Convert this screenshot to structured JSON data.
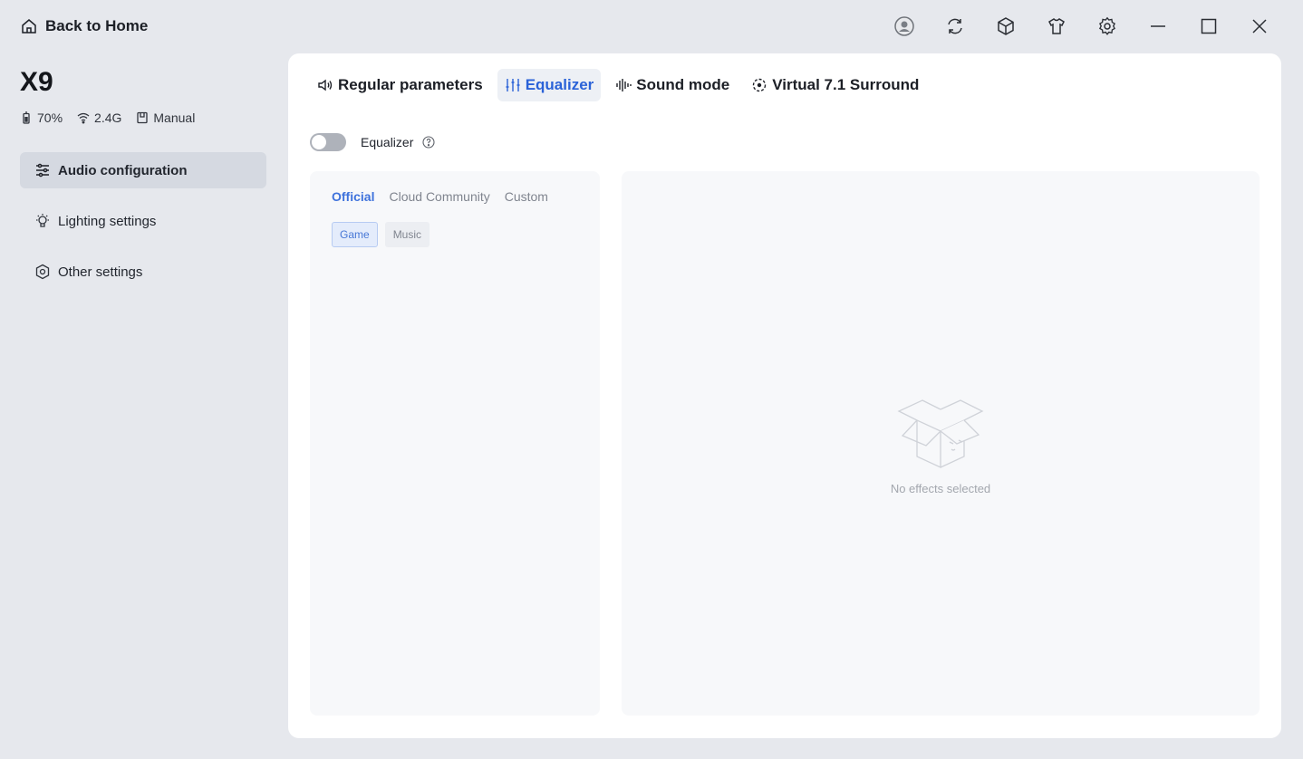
{
  "topbar": {
    "back_label": "Back to Home"
  },
  "window_icons": [
    "user-avatar-icon",
    "sync-icon",
    "cube-icon",
    "shirt-icon",
    "gear-icon",
    "minimize-icon",
    "maximize-icon",
    "close-icon"
  ],
  "device": {
    "name": "X9",
    "battery": "70%",
    "connection": "2.4G",
    "mode": "Manual"
  },
  "sidebar": {
    "items": [
      {
        "label": "Audio configuration",
        "icon": "sliders-icon",
        "active": true
      },
      {
        "label": "Lighting settings",
        "icon": "bulb-icon",
        "active": false
      },
      {
        "label": "Other settings",
        "icon": "hexagon-gear-icon",
        "active": false
      }
    ]
  },
  "tabs": [
    {
      "label": "Regular parameters",
      "icon": "speaker-icon",
      "active": false
    },
    {
      "label": "Equalizer",
      "icon": "equalizer-icon",
      "active": true
    },
    {
      "label": "Sound mode",
      "icon": "soundwave-icon",
      "active": false
    },
    {
      "label": "Virtual 7.1 Surround",
      "icon": "surround-icon",
      "active": false
    }
  ],
  "equalizer": {
    "toggle_label": "Equalizer",
    "enabled": false,
    "preset_tabs": [
      "Official",
      "Cloud Community",
      "Custom"
    ],
    "active_preset_tab": "Official",
    "categories": [
      "Game",
      "Music"
    ],
    "active_category": "Game",
    "empty_text": "No effects selected"
  },
  "colors": {
    "accent": "#2a62d8",
    "background": "#e6e8ed",
    "panel": "#ffffff"
  }
}
